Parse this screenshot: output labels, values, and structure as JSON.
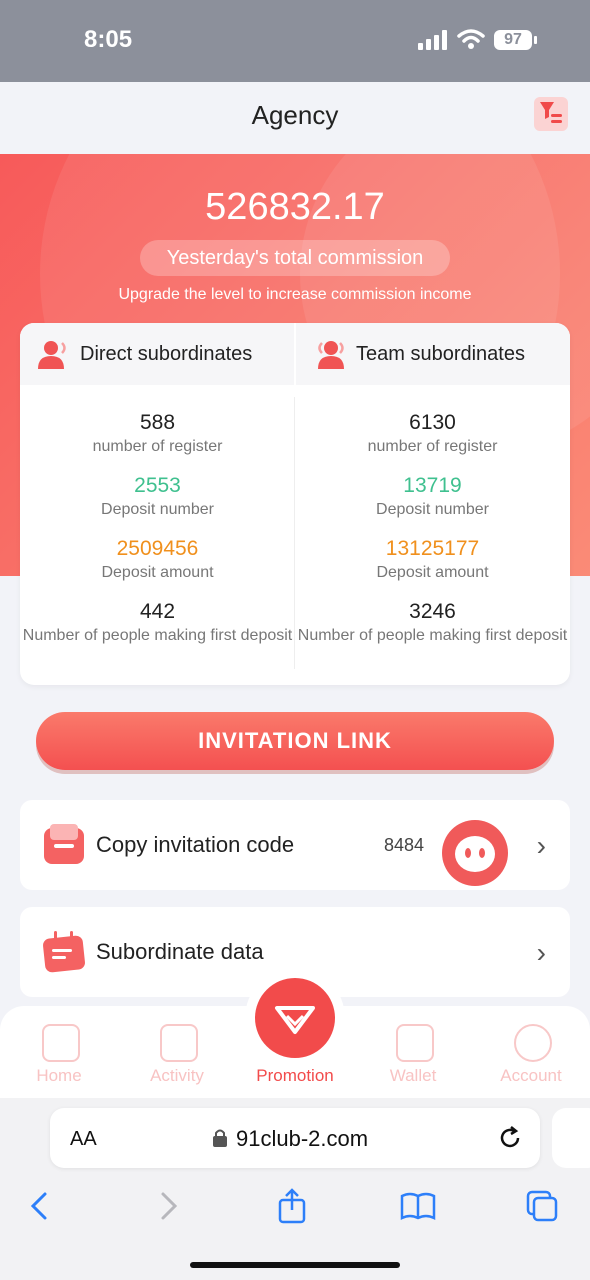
{
  "status_bar": {
    "time": "8:05",
    "battery": "97"
  },
  "header": {
    "title": "Agency"
  },
  "hero": {
    "amount": "526832.17",
    "amount_label": "Yesterday's total commission",
    "note": "Upgrade the level to increase commission income"
  },
  "stats": {
    "direct": {
      "title": "Direct subordinates",
      "register_value": "588",
      "register_label": "number of register",
      "deposit_num_value": "2553",
      "deposit_num_label": "Deposit number",
      "deposit_amt_value": "2509456",
      "deposit_amt_label": "Deposit amount",
      "first_value": "442",
      "first_label": "Number of people making first deposit"
    },
    "team": {
      "title": "Team subordinates",
      "register_value": "6130",
      "register_label": "number of register",
      "deposit_num_value": "13719",
      "deposit_num_label": "Deposit number",
      "deposit_amt_value": "13125177",
      "deposit_amt_label": "Deposit amount",
      "first_value": "3246",
      "first_label": "Number of people making first deposit"
    }
  },
  "invite_button": "INVITATION LINK",
  "rows": {
    "copy_code_label": "Copy invitation code",
    "copy_code_value": "8484",
    "subordinate_label": "Subordinate data"
  },
  "tabs": {
    "home": "Home",
    "activity": "Activity",
    "promotion": "Promotion",
    "wallet": "Wallet",
    "account": "Account"
  },
  "browser": {
    "aa": "AA",
    "url": "91club-2.com"
  },
  "colors": {
    "accent": "#f24b4b",
    "green": "#3fc08f",
    "orange": "#f0901d"
  },
  "icons": [
    "signal-icon",
    "wifi-icon",
    "filter-icon",
    "person-icon",
    "ticket-icon",
    "calendar-icon",
    "chevron-right-icon",
    "chat-icon",
    "home-icon",
    "bag-icon",
    "diamond-icon",
    "wallet-icon",
    "account-icon",
    "lock-icon",
    "reload-icon",
    "back-icon",
    "forward-icon",
    "share-icon",
    "book-icon",
    "tabs-icon"
  ]
}
